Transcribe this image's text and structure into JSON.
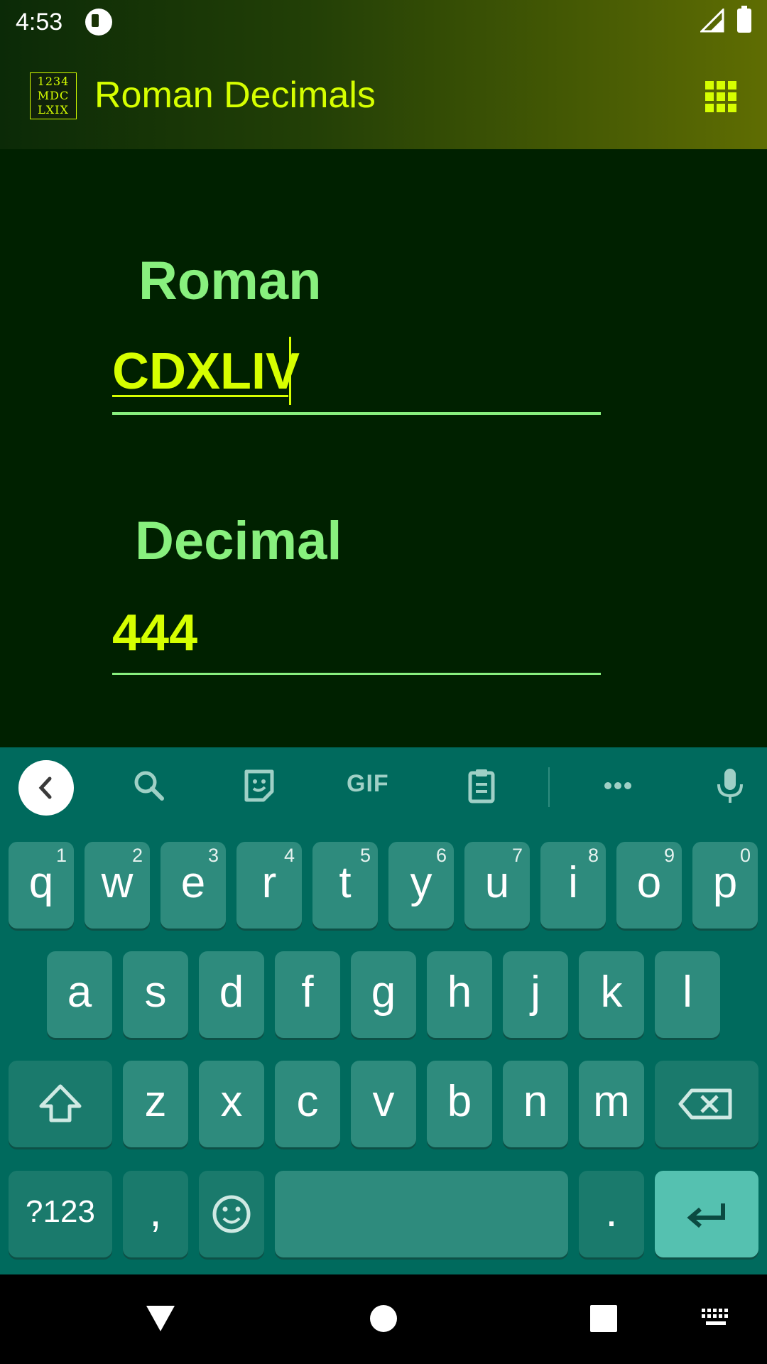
{
  "status_bar": {
    "time": "4:53"
  },
  "app_bar": {
    "logo_lines": [
      "1234",
      "MDC",
      "LXIX"
    ],
    "title": "Roman Decimals",
    "menu_icon": "grid-menu-icon"
  },
  "form": {
    "roman_label": "Roman",
    "roman_value": "CDXLIV",
    "decimal_label": "Decimal",
    "decimal_value": "444"
  },
  "keyboard": {
    "toolbar": {
      "gif_label": "GIF",
      "icons": [
        "back-icon",
        "search-icon",
        "sticker-icon",
        "clipboard-icon",
        "more-icon",
        "mic-icon"
      ]
    },
    "row1": [
      {
        "letter": "q",
        "hint": "1"
      },
      {
        "letter": "w",
        "hint": "2"
      },
      {
        "letter": "e",
        "hint": "3"
      },
      {
        "letter": "r",
        "hint": "4"
      },
      {
        "letter": "t",
        "hint": "5"
      },
      {
        "letter": "y",
        "hint": "6"
      },
      {
        "letter": "u",
        "hint": "7"
      },
      {
        "letter": "i",
        "hint": "8"
      },
      {
        "letter": "o",
        "hint": "9"
      },
      {
        "letter": "p",
        "hint": "0"
      }
    ],
    "row2": [
      "a",
      "s",
      "d",
      "f",
      "g",
      "h",
      "j",
      "k",
      "l"
    ],
    "row3": [
      "z",
      "x",
      "c",
      "v",
      "b",
      "n",
      "m"
    ],
    "row4": {
      "symbols_label": "?123",
      "comma": ",",
      "period": "."
    }
  },
  "colors": {
    "accent": "#d6ff00",
    "label": "#88f07e",
    "background": "#002100",
    "keyboard": "#006a5d"
  }
}
